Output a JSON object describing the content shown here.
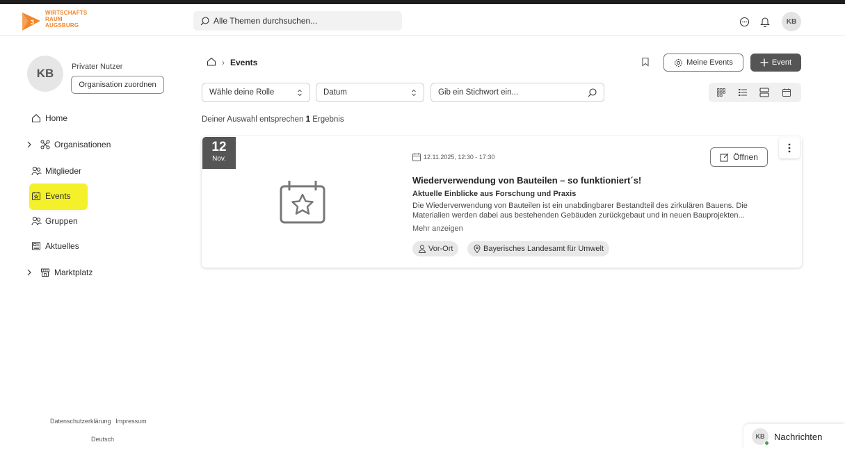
{
  "header": {
    "logo_lines": [
      "WIRTSCHAFTS",
      "RAUM",
      "AUGSBURG"
    ],
    "search_placeholder": "Alle Themen durchsuchen...",
    "avatar_initials": "KB"
  },
  "profile": {
    "initials": "KB",
    "name": "Privater Nutzer",
    "org_button": "Organisation zuordnen"
  },
  "sidebar": {
    "items": [
      {
        "label": "Home",
        "icon": "home-icon"
      },
      {
        "label": "Organisationen",
        "icon": "network-icon",
        "expandable": true
      },
      {
        "label": "Mitglieder",
        "icon": "users-icon"
      },
      {
        "label": "Events",
        "icon": "event-icon",
        "active": true
      },
      {
        "label": "Gruppen",
        "icon": "group-icon"
      },
      {
        "label": "Aktuelles",
        "icon": "news-icon"
      },
      {
        "label": "Marktplatz",
        "icon": "store-icon",
        "expandable": true
      }
    ],
    "footer_links": [
      "Datenschutzerklärung",
      "Impressum"
    ],
    "language": "Deutsch"
  },
  "breadcrumb": {
    "current": "Events"
  },
  "toolbar": {
    "my_events": "Meine Events",
    "add_event": "Event"
  },
  "filters": {
    "role": "Wähle deine Rolle",
    "date": "Datum",
    "keyword_placeholder": "Gib ein Stichwort ein..."
  },
  "results": {
    "prefix": "Deiner Auswahl entsprechen",
    "count": "1",
    "suffix": "Ergebnis"
  },
  "event": {
    "day": "12",
    "month": "Nov.",
    "datetime": "12.11.2025, 12:30 - 17:30",
    "open_label": "Öffnen",
    "title": "Wiederverwendung von Bauteilen – so funktioniert´s!",
    "subtitle": "Aktuelle Einblicke aus Forschung und Praxis",
    "description": "Die Wiederverwendung von Bauteilen ist ein unabdingbarer Bestandteil des zirkulären Bauens. Die Materialien werden dabei aus bestehenden Gebäuden zurückgebaut und in neuen Bauprojekten...",
    "more": "Mehr anzeigen",
    "tags": [
      "Vor-Ort",
      "Bayerisches Landesamt für Umwelt"
    ]
  },
  "messages": {
    "initials": "KB",
    "label": "Nachrichten",
    "online": true
  },
  "colors": {
    "accent": "#f0862b",
    "highlight": "#f4f02a",
    "dark_button": "#555555",
    "online": "#3fa34d"
  }
}
